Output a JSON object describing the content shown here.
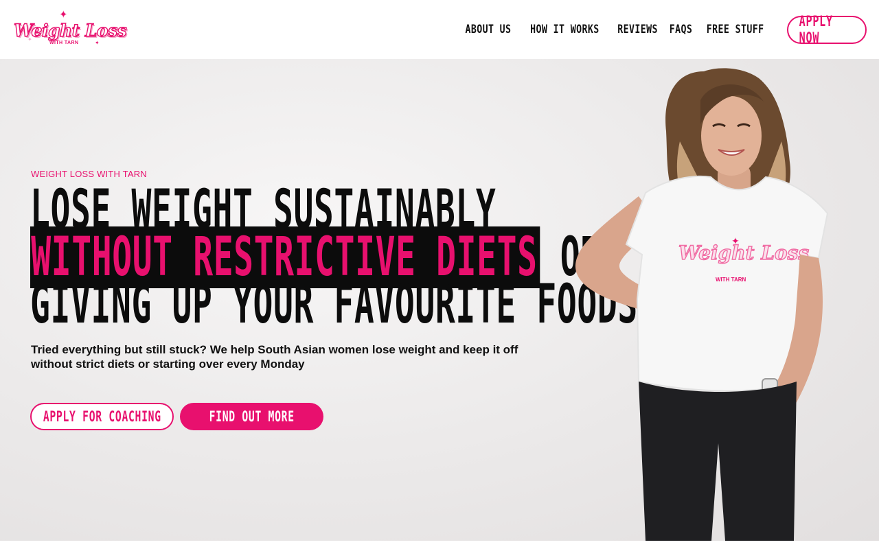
{
  "header": {
    "logo": {
      "script_text": "Weight Loss",
      "sub_text": "WITH TARN"
    },
    "nav": [
      {
        "label": "ABOUT US"
      },
      {
        "label": "HOW IT WORKS"
      },
      {
        "label": "REVIEWS"
      },
      {
        "label": "FAQS"
      },
      {
        "label": "FREE STUFF"
      }
    ],
    "apply_now_label": "APPLY NOW"
  },
  "hero": {
    "eyebrow": "WEIGHT LOSS WITH TARN",
    "headline": {
      "line1": "LOSE WEIGHT SUSTAINABLY",
      "line2_highlight": "WITHOUT RESTRICTIVE DIETS",
      "line2_rest": " OR",
      "line3": "GIVING UP YOUR FAVOURITE FOODS"
    },
    "subtext": "Tried everything but still stuck? We help South Asian women lose weight and keep it off without strict diets or starting over every Monday",
    "buttons": {
      "primary_outline": "APPLY FOR COACHING",
      "secondary_fill": "FIND OUT MORE"
    },
    "shirt_logo": {
      "script_text": "Weight Loss",
      "sub_text": "WITH TARN"
    }
  },
  "colors": {
    "accent_pink": "#e8106e",
    "text_black": "#0c0c0c",
    "hero_background": "#ebe9e9"
  },
  "icons": [
    "sparkle-icon"
  ]
}
